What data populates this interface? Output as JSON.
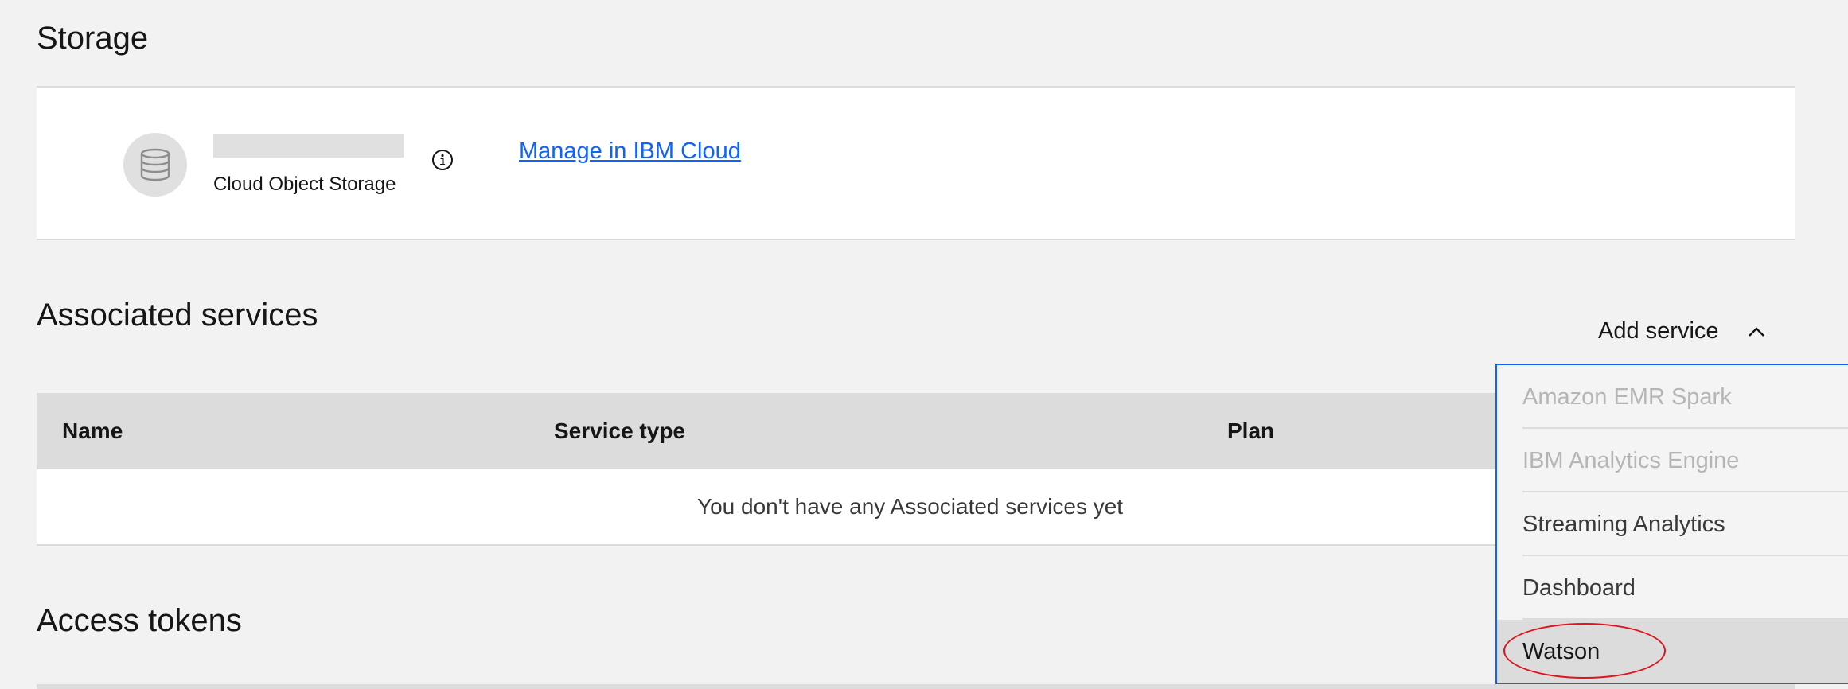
{
  "storage": {
    "title": "Storage",
    "type_label": "Cloud Object Storage",
    "manage_link": "Manage in IBM Cloud",
    "icons": {
      "avatar": "database-icon",
      "info": "info-icon"
    }
  },
  "associated_services": {
    "title": "Associated services",
    "add_service_label": "Add service",
    "add_service_icon": "chevron-up-icon",
    "table": {
      "columns": [
        "Name",
        "Service type",
        "Plan"
      ],
      "empty_message": "You don't have any Associated services yet"
    },
    "dropdown": {
      "items": [
        {
          "label": "Amazon EMR Spark",
          "disabled": true
        },
        {
          "label": "IBM Analytics Engine",
          "disabled": true
        },
        {
          "label": "Streaming Analytics",
          "disabled": false
        },
        {
          "label": "Dashboard",
          "disabled": false
        },
        {
          "label": "Watson",
          "disabled": false,
          "hovered": true,
          "annotated": true
        }
      ]
    }
  },
  "access_tokens": {
    "title": "Access tokens"
  },
  "colors": {
    "background": "#f2f2f2",
    "link": "#0f62fe",
    "dropdown_border": "#0f62fe",
    "annotation": "#e0141e",
    "header_bg": "#dcdcdc"
  }
}
